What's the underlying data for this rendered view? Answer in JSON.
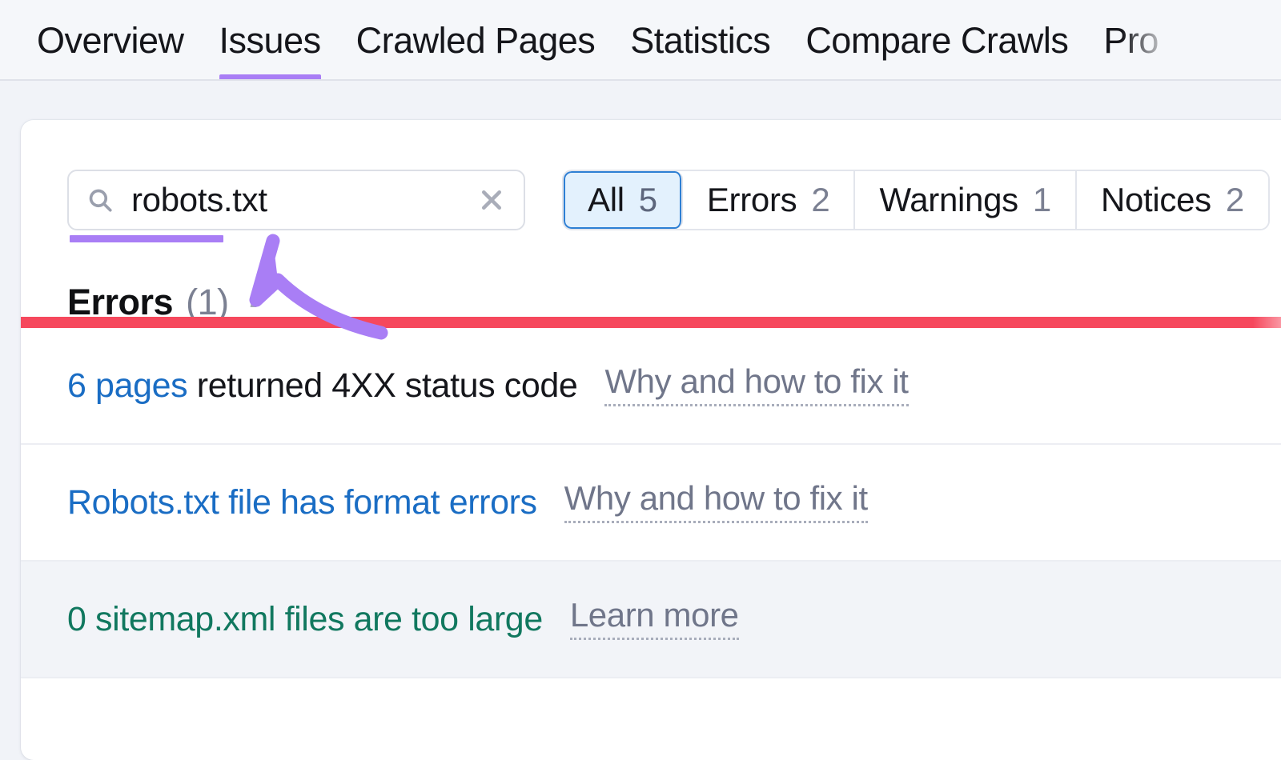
{
  "tabs": [
    {
      "label": "Overview",
      "active": false,
      "clipped": false
    },
    {
      "label": "Issues",
      "active": true,
      "clipped": false
    },
    {
      "label": "Crawled Pages",
      "active": false,
      "clipped": false
    },
    {
      "label": "Statistics",
      "active": false,
      "clipped": false
    },
    {
      "label": "Compare Crawls",
      "active": false,
      "clipped": false
    },
    {
      "label": "Pro",
      "active": false,
      "clipped": true
    }
  ],
  "search": {
    "value": "robots.txt",
    "placeholder": "Search",
    "search_icon": "search-icon",
    "clear_icon": "close-icon"
  },
  "filters": [
    {
      "label": "All",
      "count": "5",
      "active": true
    },
    {
      "label": "Errors",
      "count": "2",
      "active": false
    },
    {
      "label": "Warnings",
      "count": "1",
      "active": false
    },
    {
      "label": "Notices",
      "count": "2",
      "active": false
    }
  ],
  "section": {
    "title": "Errors",
    "count": "(1)",
    "info_icon": "info-icon"
  },
  "issues": [
    {
      "lead": "6 pages",
      "rest": " returned 4XX status code",
      "help": "Why and how to fix it",
      "style": "split-link",
      "tinted": false
    },
    {
      "lead": "",
      "rest": "Robots.txt file has format errors",
      "help": "Why and how to fix it",
      "style": "all-link",
      "tinted": false
    },
    {
      "lead": "",
      "rest": "0 sitemap.xml files are too large",
      "help": "Learn more",
      "style": "green",
      "tinted": true
    }
  ],
  "colors": {
    "accent_purple": "#a97ef5",
    "link_blue": "#1a6dc4",
    "error_red": "#f6485d",
    "notice_green": "#11785f",
    "selected_blue_bg": "#e3f1fd",
    "selected_blue_border": "#2e7fd4",
    "page_bg": "#f1f3f8"
  }
}
